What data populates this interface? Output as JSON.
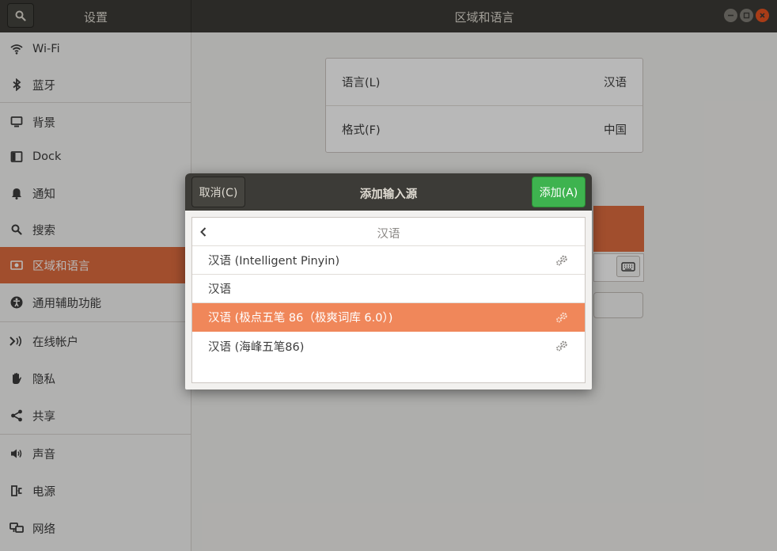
{
  "window": {
    "settings_title": "设置",
    "panel_title": "区域和语言"
  },
  "sidebar": {
    "items": [
      {
        "label": "Wi-Fi",
        "icon": "wifi-icon"
      },
      {
        "label": "蓝牙",
        "icon": "bluetooth-icon"
      },
      {
        "label": "背景",
        "icon": "background-icon"
      },
      {
        "label": "Dock",
        "icon": "dock-icon"
      },
      {
        "label": "通知",
        "icon": "bell-icon"
      },
      {
        "label": "搜索",
        "icon": "search-icon"
      },
      {
        "label": "区域和语言",
        "icon": "region-icon",
        "active": true
      },
      {
        "label": "通用辅助功能",
        "icon": "accessibility-icon"
      },
      {
        "label": "在线帐户",
        "icon": "online-accounts-icon"
      },
      {
        "label": "隐私",
        "icon": "hand-icon"
      },
      {
        "label": "共享",
        "icon": "share-icon"
      },
      {
        "label": "声音",
        "icon": "speaker-icon"
      },
      {
        "label": "电源",
        "icon": "power-icon"
      },
      {
        "label": "网络",
        "icon": "network-icon"
      }
    ]
  },
  "region_panel": {
    "language_label": "语言(L)",
    "language_value": "汉语",
    "formats_label": "格式(F)",
    "formats_value": "中国"
  },
  "dialog": {
    "title": "添加输入源",
    "cancel_label": "取消(C)",
    "add_label": "添加(A)",
    "list_header": "汉语",
    "items": [
      {
        "label": "汉语 (Intelligent Pinyin)",
        "has_settings": true
      },
      {
        "label": "汉语",
        "has_settings": false
      },
      {
        "label": "汉语 (极点五笔 86（极爽词库 6.0）)",
        "has_settings": true,
        "selected": true
      },
      {
        "label": "汉语 (海峰五笔86)",
        "has_settings": true
      }
    ]
  },
  "colors": {
    "accent": "#e06c3f",
    "selection": "#f0875a",
    "add_button": "#3eb34f",
    "headerbar": "#3c3b37"
  }
}
